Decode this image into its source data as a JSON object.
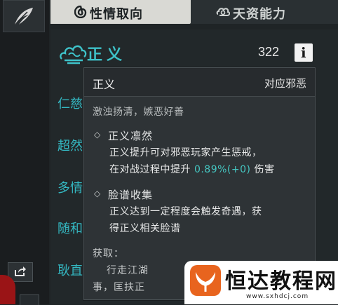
{
  "tabs": [
    {
      "label": "性情取向",
      "icon": "swirl-icon",
      "active": true
    },
    {
      "label": "天资能力",
      "icon": "cloud-swirl-icon",
      "active": false
    }
  ],
  "trait": {
    "name": "正义",
    "value": "322",
    "info_label": "i",
    "color": "#3ec2c9"
  },
  "trait_list": [
    "仁慈",
    "超然",
    "多情",
    "随和",
    "耿直"
  ],
  "tooltip": {
    "title": "正义",
    "subtitle": "对应邪恶",
    "desc": "激浊扬清，嫉恶好善",
    "sections": [
      {
        "title": "正义凛然",
        "lines": [
          "正义提升可对邪恶玩家产生惩戒，"
        ],
        "line2_prefix": "在对战过程中提升 ",
        "line2_highlight": "0.89%(+0)",
        "line2_suffix": " 伤害"
      },
      {
        "title": "脸谱收集",
        "lines": [
          "正义达到一定程度会触发奇遇，获",
          "得正义相关脸谱"
        ]
      }
    ],
    "acquire_label": "获取：",
    "acquire_lines": [
      "行走江湖",
      "事，匡扶正"
    ],
    "highlight_color": "#45c7c2"
  },
  "watermark": {
    "text": "恒达教程网",
    "url": "www.sxhdcj.com",
    "logo_color": "#e8641e"
  }
}
